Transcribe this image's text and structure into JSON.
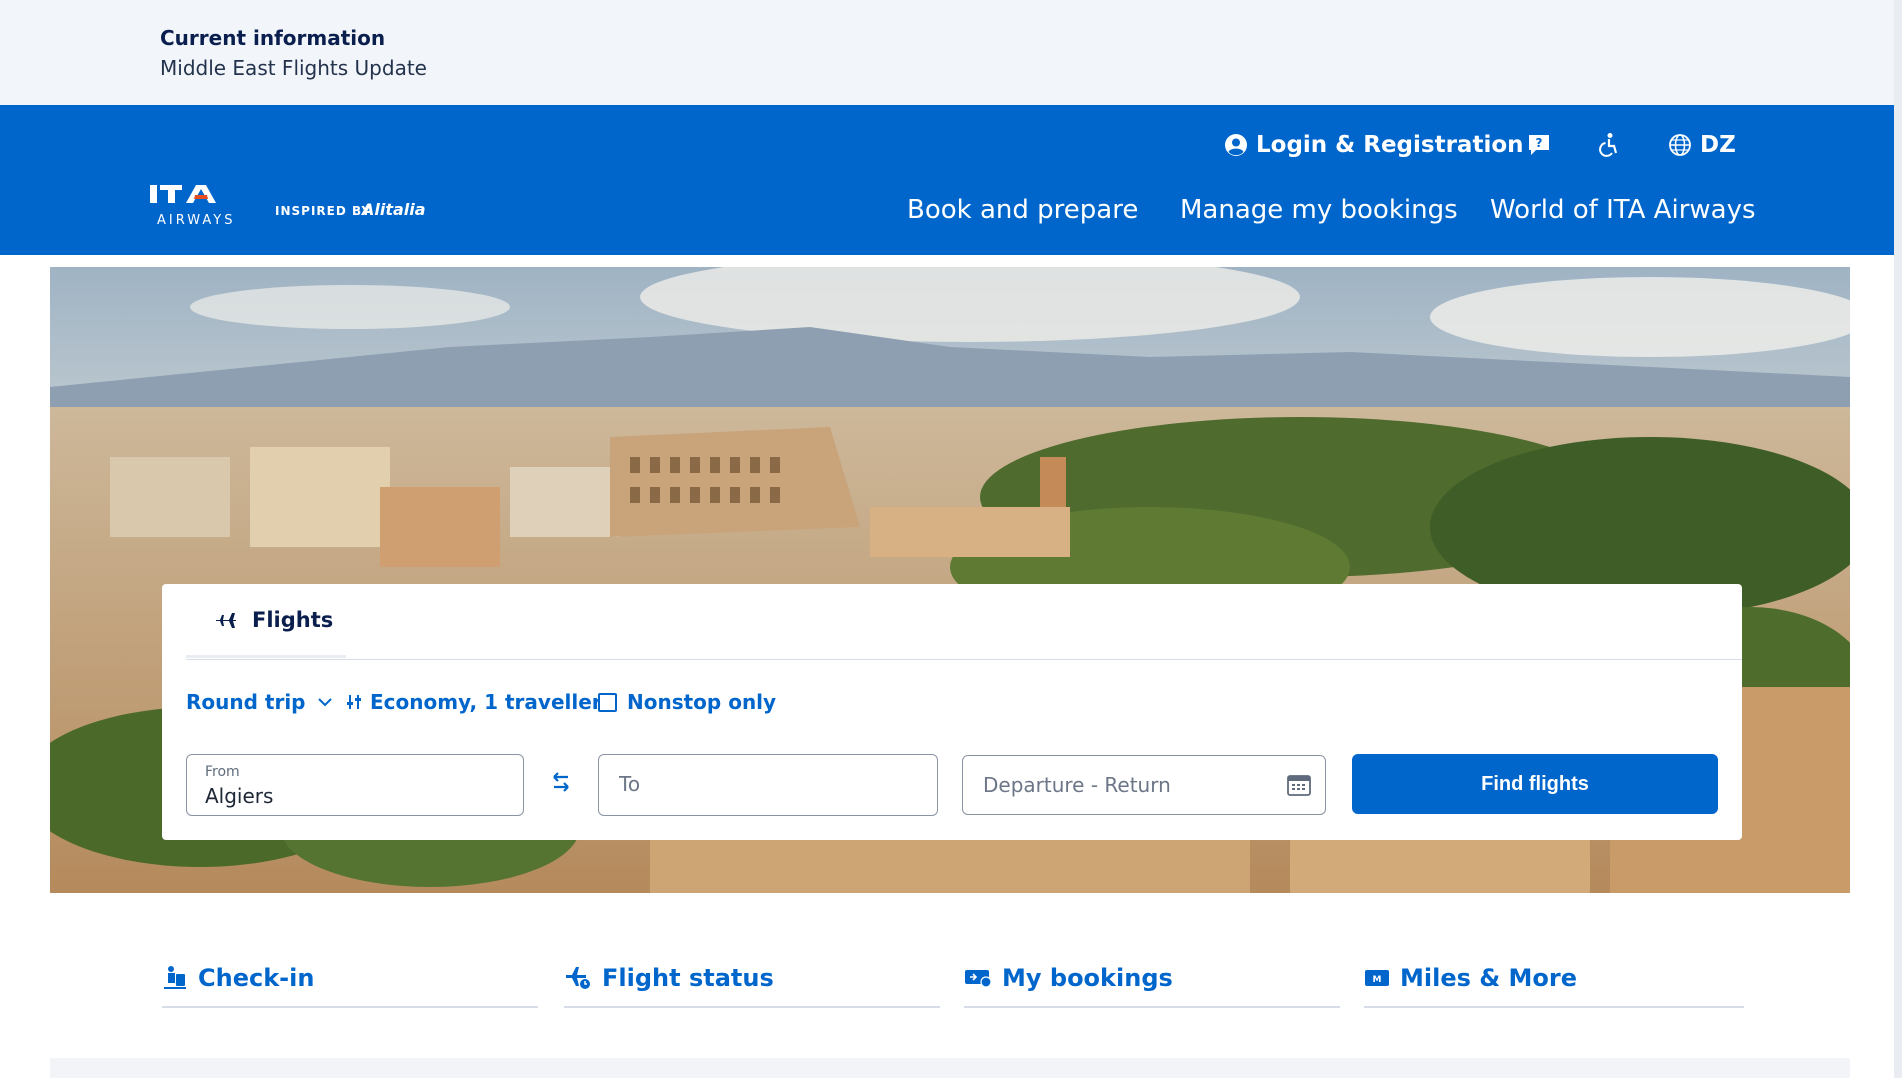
{
  "info_bar": {
    "title": "Current information",
    "link": "Middle East Flights Update"
  },
  "header": {
    "logo": {
      "brand": "ITA",
      "sub": "AIRWAYS",
      "tagline": "INSPIRED BY",
      "partner": "Alitalia"
    },
    "utility": {
      "login": "Login & Registration",
      "help_icon": "chat-question-icon",
      "accessibility_icon": "accessibility-icon",
      "language": "DZ"
    },
    "nav": [
      "Book and prepare",
      "Manage my bookings",
      "World of ITA Airways"
    ]
  },
  "search": {
    "tab": "Flights",
    "trip_type": "Round trip",
    "cabin": "Economy, 1 traveller",
    "nonstop": "Nonstop only",
    "from_label": "From",
    "from_value": "Algiers",
    "to_placeholder": "To",
    "dates_placeholder": "Departure - Return",
    "find_button": "Find flights"
  },
  "quick_links": [
    "Check-in",
    "Flight status",
    "My bookings",
    "Miles & More"
  ],
  "colors": {
    "brand_blue": "#0066cc",
    "navy": "#0b1f4e",
    "info_bg": "#f2f5f9"
  }
}
